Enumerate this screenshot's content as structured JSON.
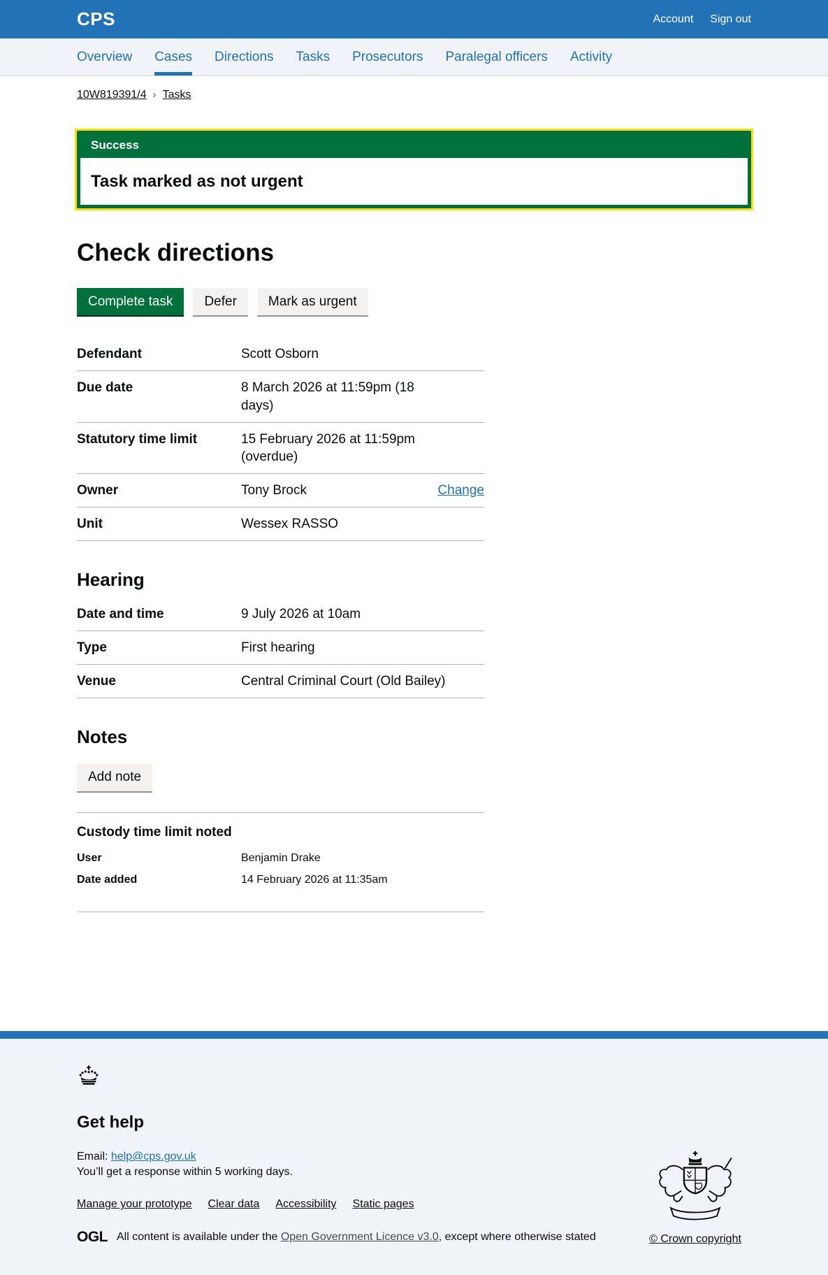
{
  "colors": {
    "brand_blue": "#2172b6",
    "link_blue": "#1d70b8",
    "success_green": "#00703c",
    "focus_yellow": "#ffdd00",
    "border_grey": "#b1b4b6"
  },
  "header": {
    "logo": "CPS",
    "account": "Account",
    "sign_out": "Sign out"
  },
  "nav": {
    "items": [
      {
        "label": "Overview",
        "active": false
      },
      {
        "label": "Cases",
        "active": true
      },
      {
        "label": "Directions",
        "active": false
      },
      {
        "label": "Tasks",
        "active": false
      },
      {
        "label": "Prosecutors",
        "active": false
      },
      {
        "label": "Paralegal officers",
        "active": false
      },
      {
        "label": "Activity",
        "active": false
      }
    ]
  },
  "breadcrumb": {
    "case_ref": "10W819391/4",
    "current": "Tasks"
  },
  "banner": {
    "title": "Success",
    "heading": "Task marked as not urgent"
  },
  "page": {
    "title": "Check directions"
  },
  "actions": {
    "complete": "Complete task",
    "defer": "Defer",
    "mark_urgent": "Mark as urgent"
  },
  "details": {
    "rows": [
      {
        "key": "Defendant",
        "value": "Scott Osborn"
      },
      {
        "key": "Due date",
        "value": "8 March 2026 at 11:59pm (18 days)"
      },
      {
        "key": "Statutory time limit",
        "value": "15 February 2026 at 11:59pm (overdue)"
      },
      {
        "key": "Owner",
        "value": "Tony Brock",
        "action": "Change"
      },
      {
        "key": "Unit",
        "value": "Wessex RASSO"
      }
    ]
  },
  "hearing": {
    "heading": "Hearing",
    "rows": [
      {
        "key": "Date and time",
        "value": "9 July 2026 at 10am"
      },
      {
        "key": "Type",
        "value": "First hearing"
      },
      {
        "key": "Venue",
        "value": "Central Criminal Court (Old Bailey)"
      }
    ]
  },
  "notes": {
    "heading": "Notes",
    "add_button": "Add note"
  },
  "custody": {
    "heading": "Custody time limit noted",
    "rows": [
      {
        "key": "User",
        "value": "Benjamin Drake"
      },
      {
        "key": "Date added",
        "value": "14 February 2026 at 11:35am"
      }
    ]
  },
  "footer": {
    "get_help": "Get help",
    "email_label": "Email:",
    "email_link": "help@cps.gov.uk",
    "response_note": "You’ll get a response within 5 working days.",
    "links": [
      {
        "label": "Manage your prototype"
      },
      {
        "label": "Clear data"
      },
      {
        "label": "Accessibility"
      },
      {
        "label": "Static pages"
      }
    ],
    "ogl": "OGL",
    "licence_prefix": "All content is available under the ",
    "licence_link": "Open Government Licence v3.0",
    "licence_suffix": ", except where otherwise stated",
    "copyright": "© Crown copyright"
  }
}
